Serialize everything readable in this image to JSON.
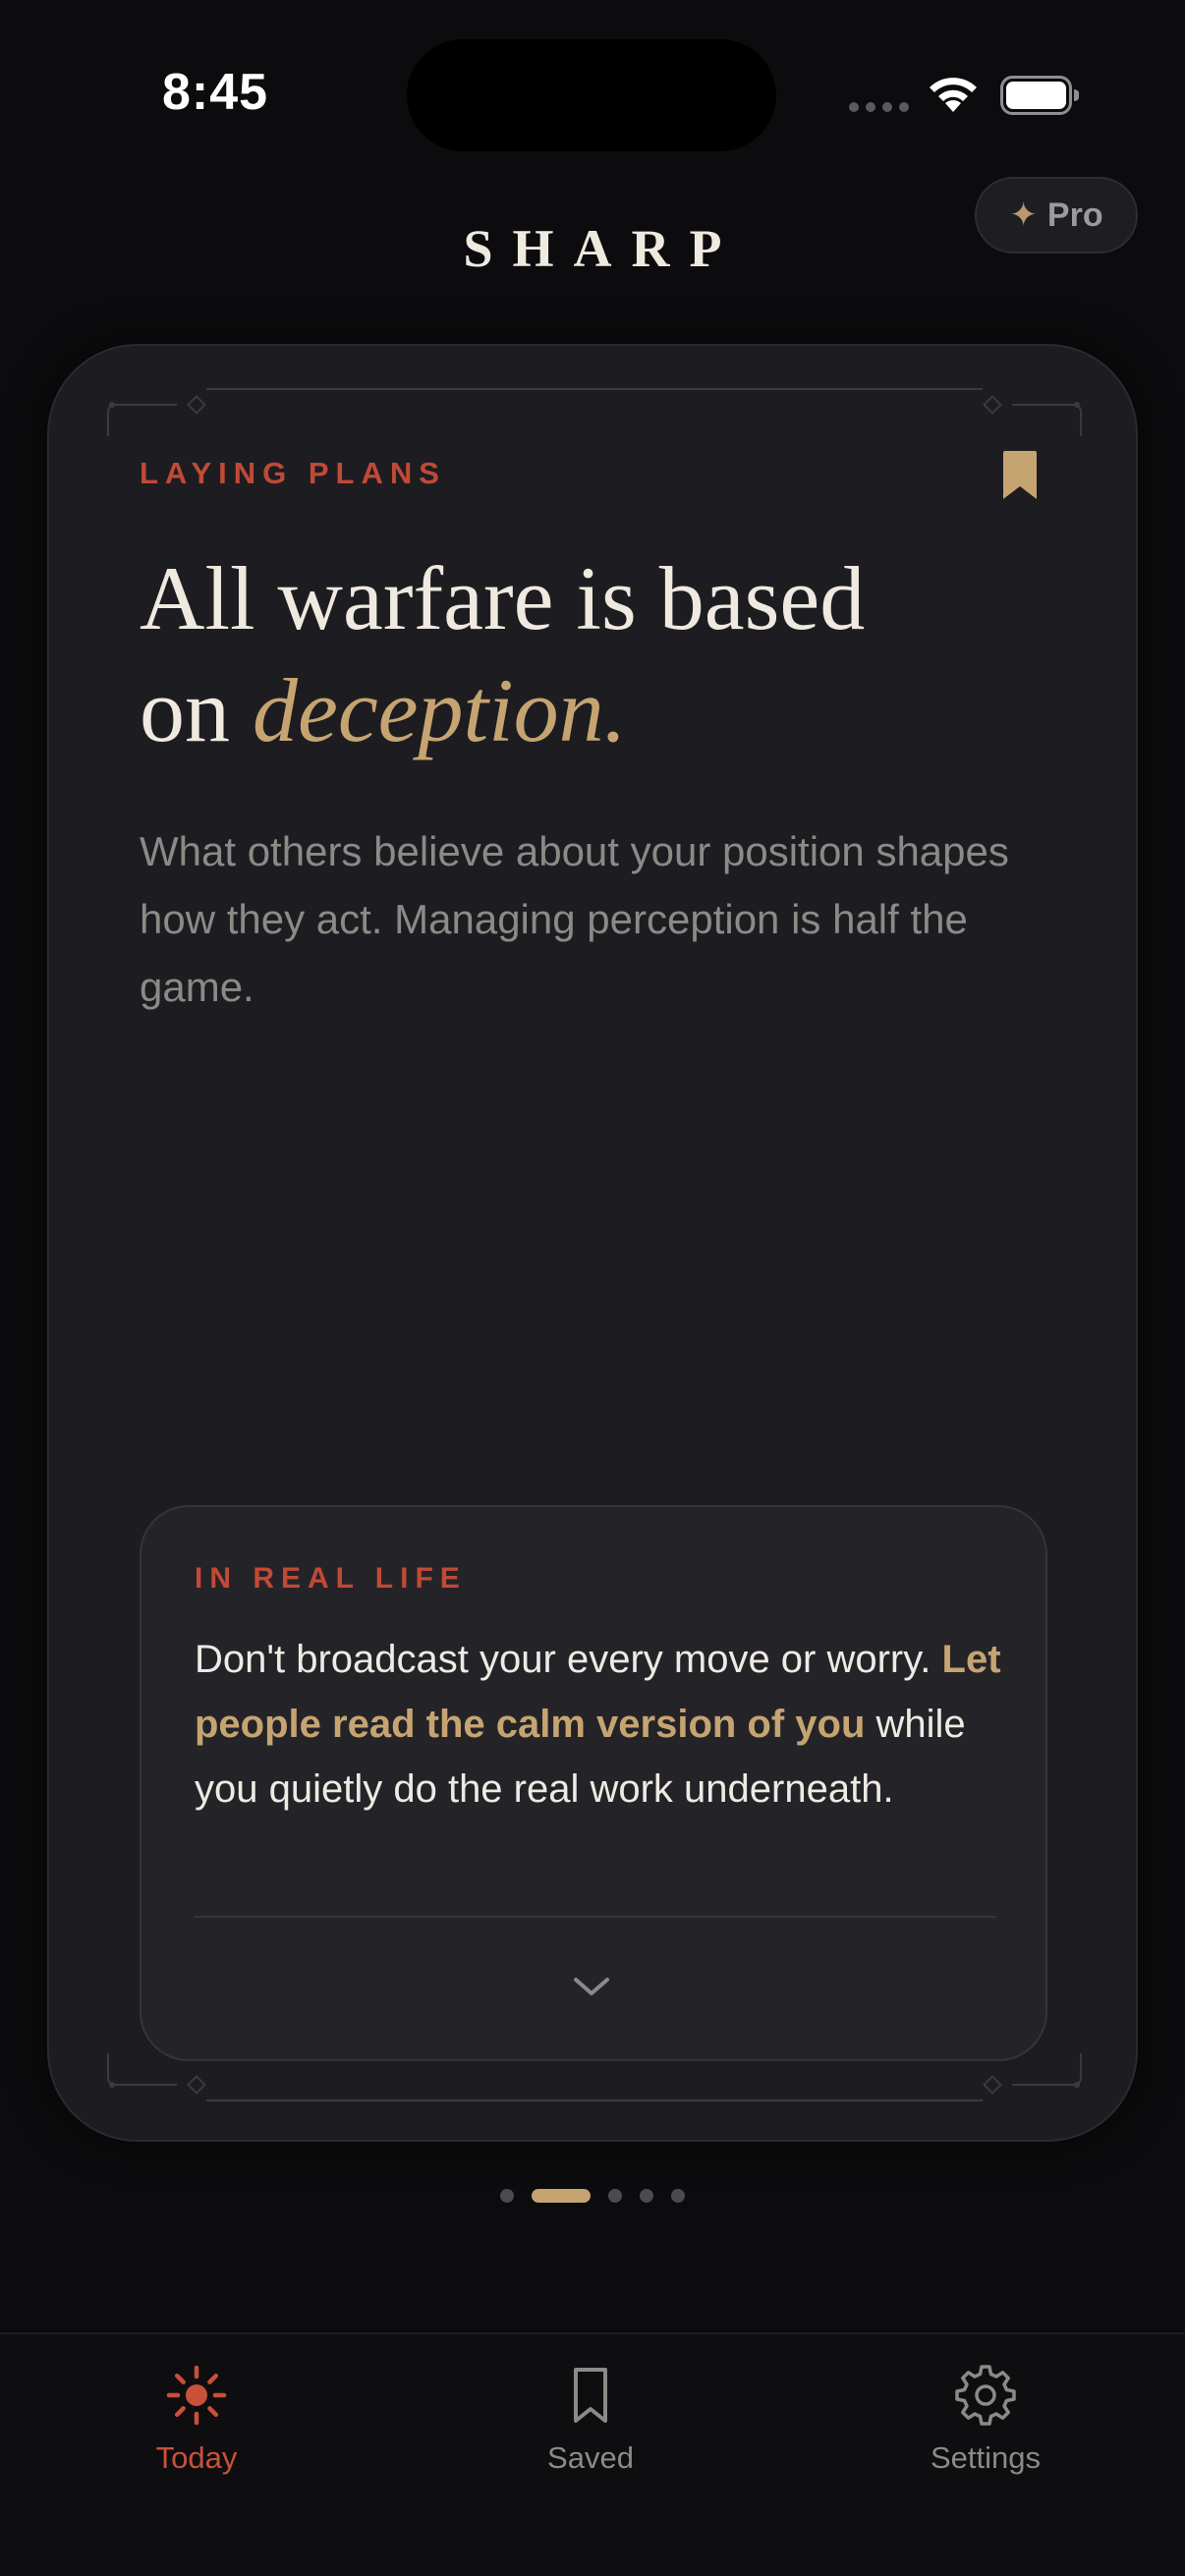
{
  "status_bar": {
    "time": "8:45"
  },
  "header": {
    "pro_label": "Pro",
    "logo": "SHARP"
  },
  "card": {
    "chapter": "LAYING PLANS",
    "headline_line1": "All warfare is based",
    "headline_on": "on ",
    "headline_emphasis": "deception.",
    "subtext": "What others believe about your position shapes how they act. Managing perception is half the game.",
    "real_life": {
      "label": "IN REAL LIFE",
      "text_before": "Don't broadcast your every move or worry. ",
      "text_highlight": "Let people read the calm version of you",
      "text_after": " while you quietly do the real work underneath."
    }
  },
  "pagination": {
    "total": 5,
    "active_index": 1
  },
  "tabbar": {
    "items": [
      {
        "label": "Today",
        "icon": "sun-icon",
        "active": true
      },
      {
        "label": "Saved",
        "icon": "bookmark-icon",
        "active": false
      },
      {
        "label": "Settings",
        "icon": "gear-icon",
        "active": false
      }
    ]
  },
  "colors": {
    "accent_red": "#c04a36",
    "accent_gold": "#c6a472",
    "background": "#0c0c0e",
    "card": "#1d1d21"
  }
}
